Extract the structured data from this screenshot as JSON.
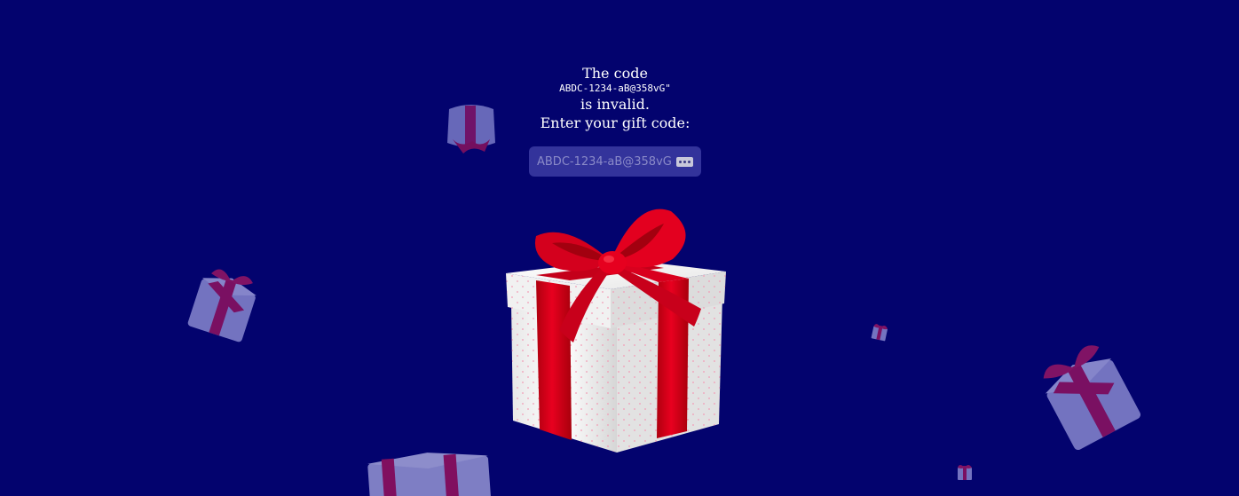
{
  "message": {
    "line1": "The code",
    "code": "ABDC-1234-aB@358vG\"",
    "line3": "is invalid.",
    "prompt": "Enter your gift code:"
  },
  "code_field": {
    "placeholder": "ABDC-1234-aB@358vG",
    "value": ""
  },
  "colors": {
    "background": "#03036e",
    "ribbon": "#d8001e",
    "box": "#f4f4f4"
  },
  "icons": [
    "password-dots-icon",
    "gift-box-icon"
  ]
}
